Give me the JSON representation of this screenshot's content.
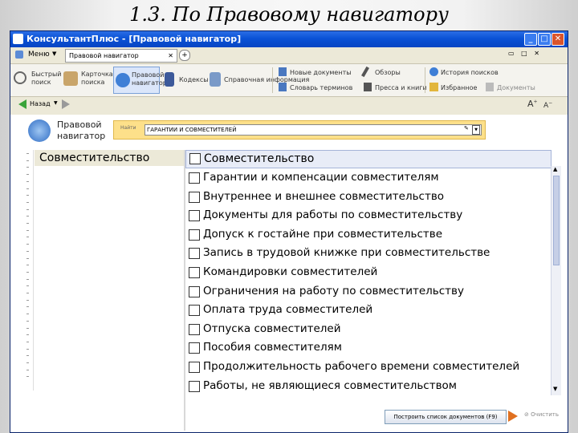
{
  "slide": {
    "title": "1.3. По Правовому навигатору"
  },
  "window": {
    "title": "КонсультантПлюс - [Правовой навигатор]"
  },
  "menu": {
    "label": "Меню",
    "tab_label": "Правовой навигатор"
  },
  "toolbar": {
    "quick_search": [
      "Быстрый",
      "поиск"
    ],
    "card_search": [
      "Карточка",
      "поиска"
    ],
    "legal_nav": [
      "Правовой",
      "навигатор"
    ],
    "codes": "Кодексы",
    "reference_info": "Справочная информация",
    "reviews": "Обзоры",
    "new_docs": "Новые документы",
    "dictionary": "Словарь терминов",
    "press_review": "Пресса и книги",
    "favorites": "Избранное",
    "history": "История поисков",
    "more": "Документы"
  },
  "nav": {
    "back_label": "Назад"
  },
  "panel": {
    "title": [
      "Правовой",
      "навигатор"
    ],
    "search_label": "Найти",
    "search_value": "ГАРАНТИИ И СОВМЕСТИТЕЛЕЙ"
  },
  "keyword": "Совместительство",
  "results": {
    "header": "Совместительство",
    "items": [
      "Гарантии и компенсации совместителям",
      "Внутреннее и внешнее совместительство",
      "Документы для работы по совместительству",
      "Допуск к гостайне при совместительстве",
      "Запись в трудовой книжке при совместительстве",
      "Командировки совместителей",
      "Ограничения на работу по совместительству",
      "Оплата труда совместителей",
      "Отпуска совместителей",
      "Пособия совместителям",
      "Продолжительность рабочего времени совместителей",
      "Работы, не являющиеся совместительством"
    ]
  },
  "bottom": {
    "build_button": "Построить список документов (F9)",
    "clear_label": "Очистить"
  },
  "colors": {
    "titlebar": "#0a52d6",
    "search_bar": "#fde08a",
    "results_header": "#e8ecf7"
  }
}
